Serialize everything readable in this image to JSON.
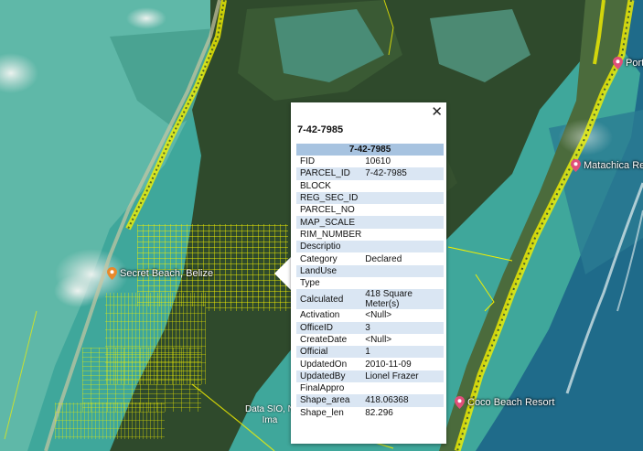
{
  "map": {
    "pois": [
      {
        "label": "Secret Beach, Belize",
        "color": "#e8892b"
      },
      {
        "label": "Matachica Res",
        "color": "#e0507a"
      },
      {
        "label": "Coco Beach Resort",
        "color": "#e0507a"
      },
      {
        "label": "Porto",
        "color": "#e0507a"
      }
    ],
    "attribution": {
      "line1": "Data SIO, N",
      "line2": "Ima"
    }
  },
  "popup": {
    "title": "7-42-7985",
    "close_glyph": "✕",
    "table_header": "7-42-7985",
    "rows": [
      {
        "key": "FID",
        "value": "10610"
      },
      {
        "key": "PARCEL_ID",
        "value": "7-42-7985"
      },
      {
        "key": "BLOCK",
        "value": ""
      },
      {
        "key": "REG_SEC_ID",
        "value": ""
      },
      {
        "key": "PARCEL_NO",
        "value": ""
      },
      {
        "key": "MAP_SCALE",
        "value": ""
      },
      {
        "key": "RIM_NUMBER",
        "value": ""
      },
      {
        "key": "Descriptio",
        "value": ""
      },
      {
        "key": "Category",
        "value": "Declared"
      },
      {
        "key": "LandUse",
        "value": ""
      },
      {
        "key": "Type",
        "value": ""
      },
      {
        "key": "Calculated",
        "value": "418 Square Meter(s)"
      },
      {
        "key": "Activation",
        "value": "<Null>"
      },
      {
        "key": "OfficeID",
        "value": "3"
      },
      {
        "key": "CreateDate",
        "value": "<Null>"
      },
      {
        "key": "Official",
        "value": "1"
      },
      {
        "key": "UpdatedOn",
        "value": "2010-11-09"
      },
      {
        "key": "UpdatedBy",
        "value": "Lionel Frazer"
      },
      {
        "key": "FinalAppro",
        "value": ""
      },
      {
        "key": "Shape_area",
        "value": "418.06368"
      },
      {
        "key": "Shape_len",
        "value": "82.296"
      }
    ]
  },
  "colors": {
    "parcel_lines": "#f4f000",
    "header_bg": "#a7c3e0",
    "alt_row_bg": "#dae6f3"
  }
}
